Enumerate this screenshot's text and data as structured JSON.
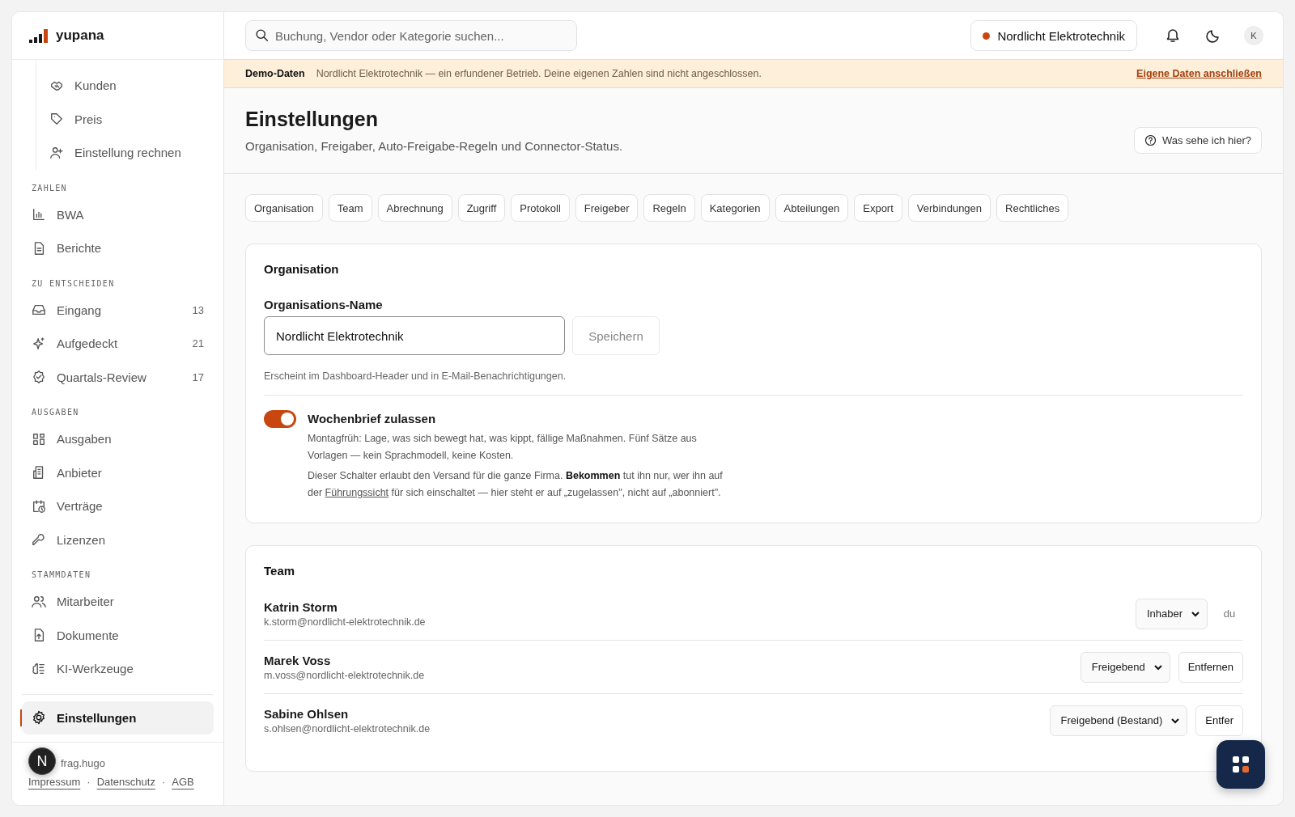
{
  "sidebar": {
    "logo": "yupana",
    "nested_items": [
      {
        "label": "Kunden",
        "selected": false
      },
      {
        "label": "Preis",
        "selected": false
      },
      {
        "label": "Einstellung rechnen",
        "selected": false
      }
    ],
    "sections": [
      {
        "heading": "ZAHLEN",
        "items": [
          {
            "label": "BWA",
            "selected": false
          },
          {
            "label": "Berichte",
            "selected": false
          }
        ]
      },
      {
        "heading": "ZU ENTSCHEIDEN",
        "items": [
          {
            "label": "Eingang",
            "count": "13",
            "selected": false
          },
          {
            "label": "Aufgedeckt",
            "count": "21",
            "selected": false
          },
          {
            "label": "Quartals-Review",
            "count": "17",
            "selected": false
          }
        ]
      },
      {
        "heading": "AUSGABEN",
        "items": [
          {
            "label": "Ausgaben",
            "selected": false
          },
          {
            "label": "Anbieter",
            "selected": false
          },
          {
            "label": "Verträge",
            "selected": false
          },
          {
            "label": "Lizenzen",
            "selected": false
          }
        ]
      },
      {
        "heading": "STAMMDATEN",
        "items": [
          {
            "label": "Mitarbeiter",
            "selected": false
          },
          {
            "label": "Dokumente",
            "selected": false
          },
          {
            "label": "KI-Werkzeuge",
            "selected": false
          }
        ]
      }
    ],
    "pinned_items": [
      {
        "label": "Einstellungen",
        "selected": true
      }
    ],
    "footer": {
      "handle": "frag.hugo",
      "links": [
        "Impressum",
        "Datenschutz",
        "AGB"
      ],
      "separator": "·",
      "badge": "N"
    }
  },
  "topbar": {
    "search": {
      "placeholder": "Buchung, Vendor oder Kategorie suchen..."
    },
    "company": "Nordlicht Elektrotechnik",
    "avatar": "K"
  },
  "banner": {
    "label": "Demo-Daten",
    "text": "Nordlicht Elektrotechnik — ein erfundener Betrieb. Deine eigenen Zahlen sind nicht angeschlossen.",
    "link": "Eigene Daten anschließen"
  },
  "page": {
    "title": "Einstellungen",
    "subtitle": "Organisation, Freigaber, Auto-Freigabe-Regeln und Connector-Status.",
    "help_button": "Was sehe ich hier?"
  },
  "tabs": [
    {
      "label": "Organisation",
      "selected": false
    },
    {
      "label": "Team",
      "selected": false
    },
    {
      "label": "Abrechnung",
      "selected": false
    },
    {
      "label": "Zugriff",
      "selected": false
    },
    {
      "label": "Protokoll",
      "selected": false
    },
    {
      "label": "Freigeber",
      "selected": false
    },
    {
      "label": "Regeln",
      "selected": false
    },
    {
      "label": "Kategorien",
      "selected": false
    },
    {
      "label": "Abteilungen",
      "selected": false
    },
    {
      "label": "Export",
      "selected": false
    },
    {
      "label": "Verbindungen",
      "selected": false
    },
    {
      "label": "Rechtliches",
      "selected": false
    }
  ],
  "organisation": {
    "title": "Organisation",
    "field_label": "Organisations-Name",
    "field_value": "Nordlicht Elektrotechnik",
    "save_button": "Speichern",
    "save_disabled": true,
    "hint": "Erscheint im Dashboard-Header und in E-Mail-Benachrichtigungen.",
    "toggle": {
      "label": "Wochenbrief zulassen",
      "on": true,
      "description": "Montagfrüh: Lage, was sich bewegt hat, was kippt, fällige Maßnahmen. Fünf Sätze aus Vorlagen — kein Sprachmodell, keine Kosten.",
      "note": {
        "before": "Dieser Schalter erlaubt den Versand für die ganze Firma. **Bekommen** tut ihn nur, wer ihn auf der ",
        "link": "Führungssicht",
        "after": " für sich einschaltet — hier steht er auf „zugelassen\", nicht auf „abonniert\"."
      }
    }
  },
  "team": {
    "title": "Team",
    "members": [
      {
        "name": "Katrin Storm",
        "email": "k.storm@nordlicht-elektrotechnik.de",
        "role": "Inhaber",
        "kind": "self",
        "action": "du"
      },
      {
        "name": "Marek Voss",
        "email": "m.voss@nordlicht-elektrotechnik.de",
        "role": "Freigebend",
        "kind": "member",
        "action": "Entfernen"
      },
      {
        "name": "Sabine Ohlsen",
        "email": "s.ohlsen@nordlicht-elektrotechnik.de",
        "role": "Freigebend (Bestand)",
        "kind": "member",
        "action": "Entfer"
      }
    ]
  }
}
